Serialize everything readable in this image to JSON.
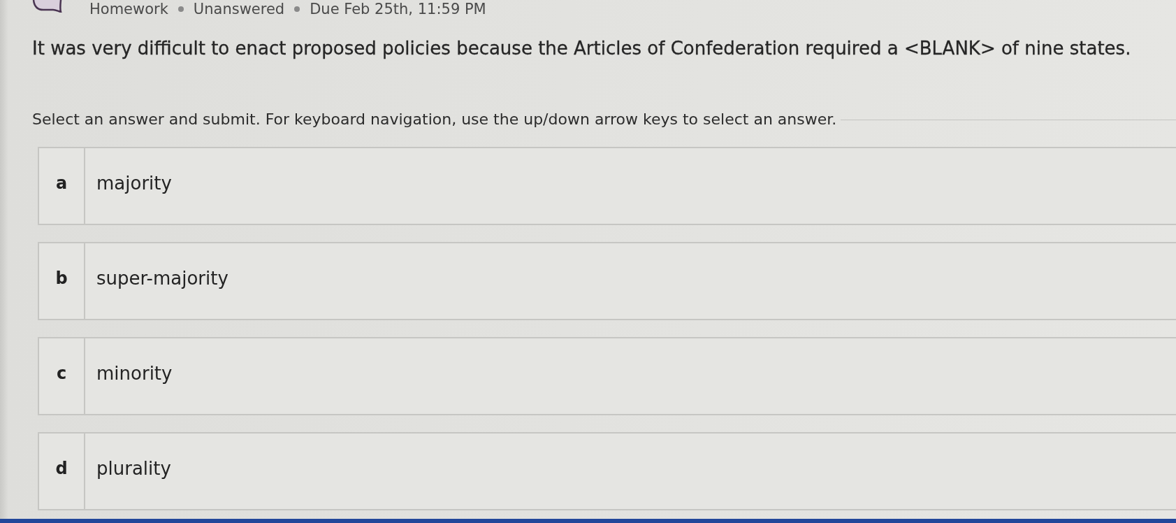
{
  "header": {
    "items": [
      "Homework",
      "Unanswered",
      "Due Feb 25th, 11:59 PM"
    ]
  },
  "question": "It was very difficult to enact proposed policies because the Articles of Confederation required a <BLANK> of nine states.",
  "instruction": "Select an answer and submit. For keyboard navigation, use the up/down arrow keys to select an answer.",
  "options": [
    {
      "letter": "a",
      "text": "majority",
      "selected": false
    },
    {
      "letter": "b",
      "text": "super-majority",
      "selected": false
    },
    {
      "letter": "c",
      "text": "minority",
      "selected": false
    },
    {
      "letter": "d",
      "text": "plurality",
      "selected": false
    }
  ]
}
